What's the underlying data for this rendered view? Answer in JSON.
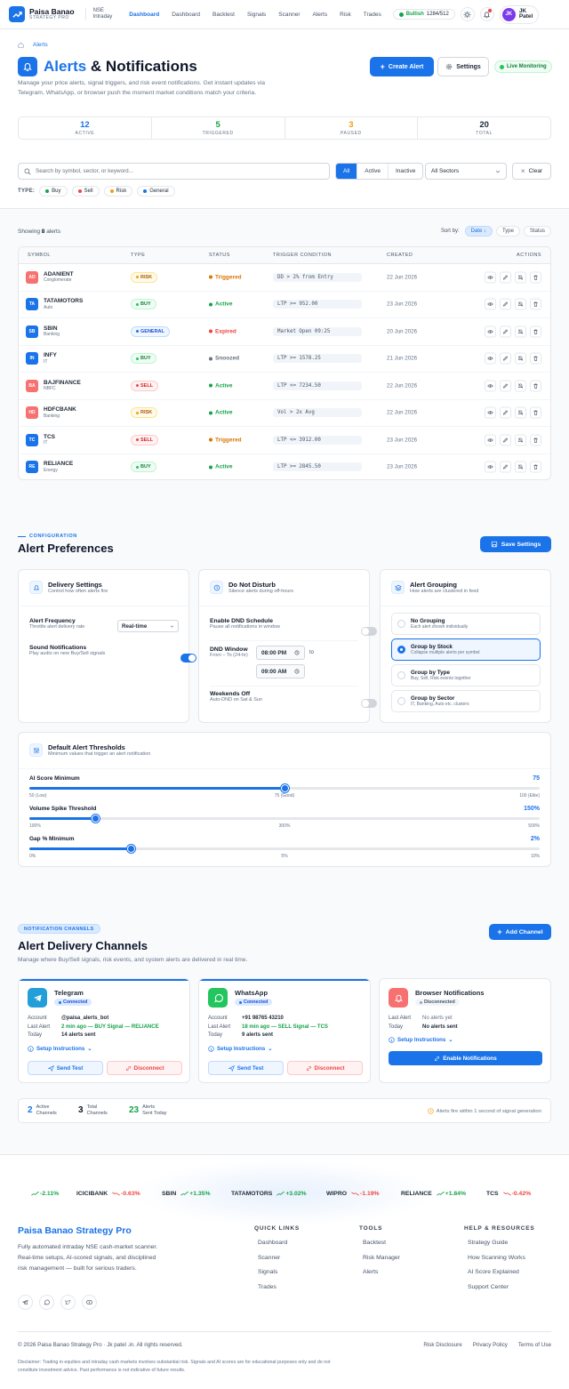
{
  "nav": {
    "brand": "Paisa Banao",
    "brand_sub": "STRATEGY PRO",
    "market": "NSE",
    "mode": "Intraday",
    "links": [
      "Dashboard",
      "Dashboard",
      "Backtest",
      "Signals",
      "Scanner",
      "Alerts",
      "Risk",
      "Trades"
    ],
    "sentiment": "Bullish",
    "ratio": "1284/512",
    "user_initials": "JK",
    "user_first": "JK",
    "user_last": "Patel"
  },
  "header": {
    "crumb": "Alerts",
    "title_accent": "Alerts",
    "title_rest": "& Notifications",
    "description": "Manage your price alerts, signal triggers, and risk event notifications. Get instant updates via Telegram, WhatsApp, or browser push the moment market conditions match your criteria.",
    "create": "Create Alert",
    "settings": "Settings",
    "live": "Live Monitoring"
  },
  "stats": [
    {
      "value": "12",
      "label": "ACTIVE",
      "color": "#1a73e8"
    },
    {
      "value": "5",
      "label": "TRIGGERED",
      "color": "#16a34a"
    },
    {
      "value": "3",
      "label": "PAUSED",
      "color": "#f59e0b"
    },
    {
      "value": "20",
      "label": "TOTAL",
      "color": "#0f172a"
    }
  ],
  "filters": {
    "search_placeholder": "Search by symbol, sector, or keyword...",
    "seg": [
      "All",
      "Active",
      "Inactive"
    ],
    "sector": "All Sectors",
    "clear": "Clear",
    "type_label": "TYPE:",
    "types": [
      {
        "label": "Buy",
        "color": "#16a34a"
      },
      {
        "label": "Sell",
        "color": "#ef4444"
      },
      {
        "label": "Risk",
        "color": "#f59e0b"
      },
      {
        "label": "General",
        "color": "#1a73e8"
      }
    ]
  },
  "table": {
    "showing_prefix": "Showing",
    "showing_count": "8",
    "showing_suffix": "alerts",
    "sort_label": "Sort by:",
    "sorts": [
      "Date ↓",
      "Type",
      "Status"
    ],
    "headers": [
      "SYMBOL",
      "TYPE",
      "STATUS",
      "TRIGGER CONDITION",
      "CREATED",
      "ACTIONS"
    ],
    "rows": [
      {
        "abbr": "AD",
        "symbol": "ADANIENT",
        "sector": "Conglomerate",
        "type": "RISK",
        "status": "Triggered",
        "condition": "DD > 2% from Entry",
        "created": "22 Jun 2026",
        "color": "#f87171"
      },
      {
        "abbr": "TA",
        "symbol": "TATAMOTORS",
        "sector": "Auto",
        "type": "BUY",
        "status": "Active",
        "condition": "LTP >= 952.00",
        "created": "23 Jun 2026",
        "color": "#1a73e8"
      },
      {
        "abbr": "SB",
        "symbol": "SBIN",
        "sector": "Banking",
        "type": "GENERAL",
        "status": "Expired",
        "condition": "Market Open 09:25",
        "created": "20 Jun 2026",
        "color": "#1a73e8"
      },
      {
        "abbr": "IN",
        "symbol": "INFY",
        "sector": "IT",
        "type": "BUY",
        "status": "Snoozed",
        "condition": "LTP >= 1578.25",
        "created": "21 Jun 2026",
        "color": "#1a73e8"
      },
      {
        "abbr": "BA",
        "symbol": "BAJFINANCE",
        "sector": "NBFC",
        "type": "SELL",
        "status": "Active",
        "condition": "LTP <= 7234.50",
        "created": "22 Jun 2026",
        "color": "#f87171"
      },
      {
        "abbr": "HD",
        "symbol": "HDFCBANK",
        "sector": "Banking",
        "type": "RISK",
        "status": "Active",
        "condition": "Vol > 2x Avg",
        "created": "22 Jun 2026",
        "color": "#f87171"
      },
      {
        "abbr": "TC",
        "symbol": "TCS",
        "sector": "IT",
        "type": "SELL",
        "status": "Triggered",
        "condition": "LTP <= 3912.00",
        "created": "23 Jun 2026",
        "color": "#1a73e8"
      },
      {
        "abbr": "RE",
        "symbol": "RELIANCE",
        "sector": "Energy",
        "type": "BUY",
        "status": "Active",
        "condition": "LTP >= 2845.50",
        "created": "23 Jun 2026",
        "color": "#1a73e8"
      }
    ]
  },
  "prefs": {
    "eyebrow": "CONFIGURATION",
    "title": "Alert Preferences",
    "save": "Save Settings",
    "delivery": {
      "title": "Delivery Settings",
      "sub": "Control how often alerts fire",
      "freq": "Alert Frequency",
      "freq_sub": "Throttle alert delivery rate",
      "freq_val": "Real-time",
      "sound": "Sound Notifications",
      "sound_sub": "Play audio on new Buy/Sell signals"
    },
    "dnd": {
      "title": "Do Not Disturb",
      "sub": "Silence alerts during off-hours",
      "enable": "Enable DND Schedule",
      "enable_sub": "Pause all notifications in window",
      "window": "DND Window",
      "window_sub": "From – To (24-hr)",
      "from": "08:00 PM",
      "to_label": "to",
      "to": "09:00 AM",
      "weekends": "Weekends Off",
      "weekends_sub": "Auto-DND on Sat & Sun"
    },
    "grouping": {
      "title": "Alert Grouping",
      "sub": "How alerts are clustered in feed",
      "options": [
        {
          "label": "No Grouping",
          "sub": "Each alert shown individually"
        },
        {
          "label": "Group by Stock",
          "sub": "Collapse multiple alerts per symbol"
        },
        {
          "label": "Group by Type",
          "sub": "Buy, Sell, Risk events together"
        },
        {
          "label": "Group by Sector",
          "sub": "IT, Banking, Auto etc. clusters"
        }
      ]
    },
    "thresholds": {
      "title": "Default Alert Thresholds",
      "sub": "Minimum values that trigger an alert notification",
      "sliders": [
        {
          "label": "AI Score Minimum",
          "value": "75",
          "level": 0.5,
          "min": "50 (Low)",
          "mid": "75 (Good)",
          "max": "100 (Elite)"
        },
        {
          "label": "Volume Spike Threshold",
          "value": "150%",
          "level": 0.13,
          "min": "100%",
          "mid": "300%",
          "max": "500%"
        },
        {
          "label": "Gap % Minimum",
          "value": "2%",
          "level": 0.2,
          "min": "0%",
          "mid": "5%",
          "max": "10%"
        }
      ]
    }
  },
  "channels": {
    "eyebrow": "NOTIFICATION CHANNELS",
    "title": "Alert Delivery Channels",
    "sub": "Manage where Buy/Sell signals, risk events, and system alerts are delivered in real time.",
    "add": "Add Channel",
    "telegram": {
      "name": "Telegram",
      "status": "Connected",
      "account": "@paisa_alerts_bot",
      "last": "2 min ago — BUY Signal — RELIANCE",
      "today": "14 alerts sent"
    },
    "whatsapp": {
      "name": "WhatsApp",
      "status": "Connected",
      "account": "+91 98765 43210",
      "last": "18 min ago — SELL Signal — TCS",
      "today": "9 alerts sent"
    },
    "browser": {
      "name": "Browser Notifications",
      "status": "Disconnected",
      "last": "No alerts yet",
      "today": "No alerts sent",
      "enable": "Enable Notifications"
    },
    "k_account": "Account",
    "k_last": "Last Alert",
    "k_today": "Today",
    "setup": "Setup Instructions",
    "send": "Send Test",
    "disconnect": "Disconnect",
    "summary": [
      {
        "n": "2",
        "l1": "Active",
        "l2": "Channels"
      },
      {
        "n": "3",
        "l1": "Total",
        "l2": "Channels"
      },
      {
        "n": "23",
        "l1": "Alerts",
        "l2": "Sent Today"
      }
    ],
    "note": "Alerts fire within 1 second of signal generation"
  },
  "footer": {
    "ticker": [
      {
        "sym": "",
        "chg": "-2.11%",
        "up": true
      },
      {
        "sym": "ICICIBANK",
        "chg": "-0.63%",
        "up": false
      },
      {
        "sym": "SBIN",
        "chg": "+1.35%",
        "up": true
      },
      {
        "sym": "TATAMOTORS",
        "chg": "+3.02%",
        "up": true
      },
      {
        "sym": "WIPRO",
        "chg": "-1.19%",
        "up": false
      },
      {
        "sym": "RELIANCE",
        "chg": "+1.84%",
        "up": true
      },
      {
        "sym": "TCS",
        "chg": "-0.42%",
        "up": false
      }
    ],
    "brand": "Paisa Banao Strategy Pro",
    "about": "Fully automated intraday NSE cash-market scanner. Real-time setups, AI-scored signals, and disciplined risk management — built for serious traders.",
    "cols": [
      {
        "h": "QUICK LINKS",
        "items": [
          "Dashboard",
          "Scanner",
          "Signals",
          "Trades"
        ]
      },
      {
        "h": "TOOLS",
        "items": [
          "Backtest",
          "Risk Manager",
          "Alerts"
        ]
      },
      {
        "h": "HELP & RESOURCES",
        "items": [
          "Strategy Guide",
          "How Scanning Works",
          "AI Score Explained",
          "Support Center"
        ]
      }
    ],
    "copyright": "© 2026 Paisa Banao Strategy Pro · Jk patel .in. All rights reserved.",
    "legal": [
      "Risk Disclosure",
      "Privacy Policy",
      "Terms of Use"
    ],
    "disclaimer": "Disclaimer: Trading in equities and intraday cash markets involves substantial risk. Signals and AI scores are for educational purposes only and do not constitute investment advice. Past performance is not indicative of future results."
  }
}
